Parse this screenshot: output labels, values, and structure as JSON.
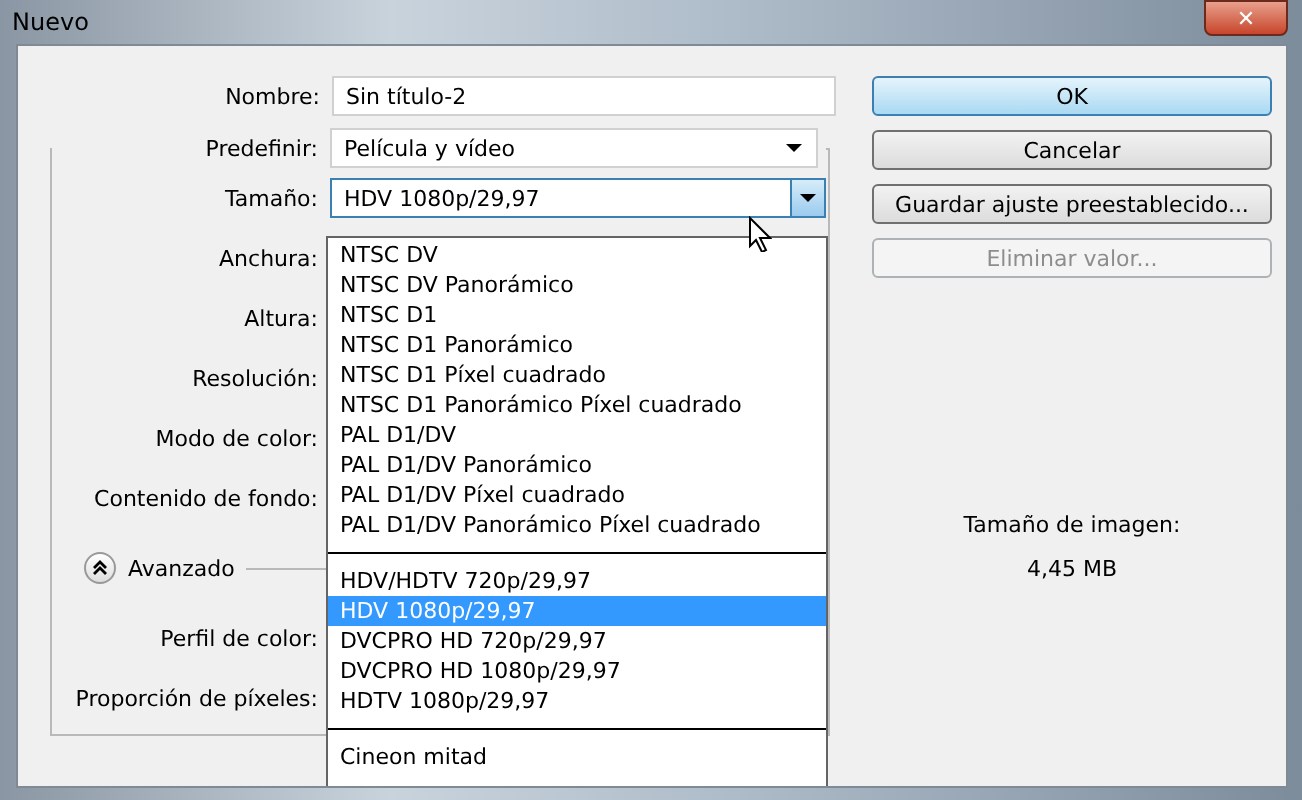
{
  "window": {
    "title": "Nuevo",
    "close": "✕"
  },
  "name_field": {
    "label": "Nombre:",
    "value": "Sin título-2"
  },
  "preset": {
    "label": "Predefinir:",
    "value": "Película y vídeo"
  },
  "size": {
    "label": "Tamaño:",
    "value": "HDV 1080p/29,97",
    "open": true
  },
  "field_labels": [
    "Anchura:",
    "Altura:",
    "Resolución:",
    "Modo de color:",
    "Contenido de fondo:"
  ],
  "advanced": {
    "label": "Avanzado",
    "expanded": true
  },
  "advanced_labels": [
    "Perfil de color:",
    "Proporción de píxeles:"
  ],
  "size_options": [
    {
      "label": "NTSC DV",
      "selected": false
    },
    {
      "label": "NTSC DV Panorámico",
      "selected": false
    },
    {
      "label": "NTSC D1",
      "selected": false
    },
    {
      "label": "NTSC D1 Panorámico",
      "selected": false
    },
    {
      "label": "NTSC D1 Píxel cuadrado",
      "selected": false
    },
    {
      "label": "NTSC D1 Panorámico Píxel cuadrado",
      "selected": false
    },
    {
      "label": "PAL D1/DV",
      "selected": false
    },
    {
      "label": "PAL D1/DV Panorámico",
      "selected": false
    },
    {
      "label": "PAL D1/DV Píxel cuadrado",
      "selected": false
    },
    {
      "label": "PAL D1/DV Panorámico Píxel cuadrado",
      "selected": false
    },
    {
      "kind": "separator"
    },
    {
      "label": "HDV/HDTV 720p/29,97",
      "selected": false
    },
    {
      "label": "HDV 1080p/29,97",
      "selected": true
    },
    {
      "label": "DVCPRO HD 720p/29,97",
      "selected": false
    },
    {
      "label": "DVCPRO HD 1080p/29,97",
      "selected": false
    },
    {
      "label": "HDTV 1080p/29,97",
      "selected": false
    },
    {
      "kind": "separator"
    },
    {
      "label": "Cineon mitad",
      "selected": false
    }
  ],
  "buttons": [
    {
      "label": "OK",
      "default": true,
      "disabled": false
    },
    {
      "label": "Cancelar",
      "default": false,
      "disabled": false
    },
    {
      "label": "Guardar ajuste preestablecido...",
      "default": false,
      "disabled": false
    },
    {
      "label": "Eliminar valor...",
      "default": false,
      "disabled": true
    }
  ],
  "image_size": {
    "label": "Tamaño de imagen:",
    "value": "4,45 MB"
  }
}
